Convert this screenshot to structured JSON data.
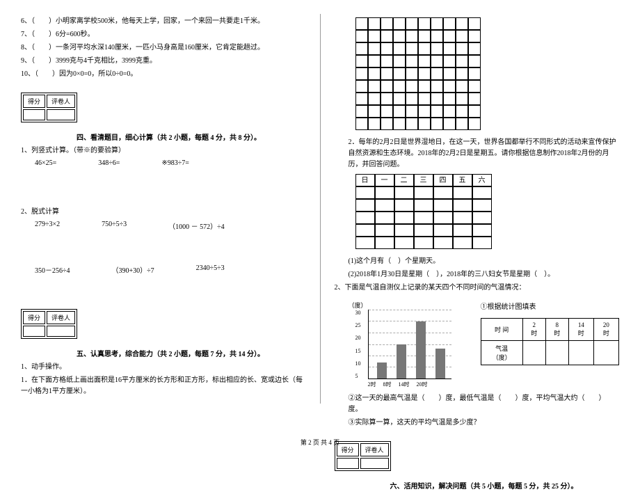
{
  "left": {
    "q6": "6、（　　）小明家离学校500米，他每天上学，回家，一个来回一共要走1千米。",
    "q7": "7、（　　）6分=600秒。",
    "q8": "8、（　　）一条河平均水深140厘米，一匹小马身高是160厘米，它肯定能趟过。",
    "q9": "9、（　　）3999克与4千克相比，3999克重。",
    "q10": "10、（　　）因为0×0=0，所以0÷0=0。",
    "score_label_1": "得分",
    "score_label_2": "评卷人",
    "section4_title": "四、看清题目，细心计算（共 2 小题，每题 4 分，共 8 分）。",
    "s4_q1": "1、列竖式计算。（带※的要验算）",
    "calc1_a": "46×25=",
    "calc1_b": "348÷6=",
    "calc1_c": "※983÷7=",
    "s4_q2": "2、脱式计算",
    "calc2_a": "279÷3×2",
    "calc2_b": "750÷5÷3",
    "calc2_c": "（1000 － 572）÷4",
    "calc3_a": "350－256÷4",
    "calc3_b": "（390+30）÷7",
    "calc3_c": "2340÷5÷3",
    "section5_title": "五、认真思考，综合能力（共 2 小题，每题 7 分，共 14 分）。",
    "s5_q1": "1、动手操作。",
    "s5_q1_sub": "1．在下面方格纸上画出面积是16平方厘米的长方形和正方形，标出相应的长、宽或边长（每一小格为1平方厘米）。"
  },
  "right": {
    "s5_q2": "2．每年的2月2日是世界湿地日，在这一天，世界各国都举行不同形式的活动来宣传保护自然资源和生态环境。2018年的2月2日是星期五。请你根据信息制作2018年2月份的月历，并回答问题。",
    "cal_days": [
      "日",
      "一",
      "二",
      "三",
      "四",
      "五",
      "六"
    ],
    "s5_q2_sub1": "(1)这个月有（　）个星期天。",
    "s5_q2_sub2": "(2)2018年1月30日是星期（　），2018年的三八妇女节是星期（　）。",
    "s5_q3": "2、下面是气温自测仪上记录的某天四个不同时间的气温情况：",
    "chart_label": "（度）",
    "chart_table_title": "①根据统计图填表",
    "table_header_time": "时  间",
    "table_header_temp": "气温（度）",
    "table_times": [
      "2时",
      "8时",
      "14时",
      "20时"
    ],
    "s5_q3_sub2": "②这一天的最高气温是（　　）度，最低气温是（　　）度，平均气温大约（　　）度。",
    "s5_q3_sub3": "③实际算一算，这天的平均气温是多少度？",
    "section6_title": "六、活用知识，解决问题（共 5 小题，每题 5 分，共 25 分）。"
  },
  "chart_data": {
    "type": "bar",
    "categories": [
      "2时",
      "8时",
      "14时",
      "20时"
    ],
    "values": [
      7,
      15,
      25,
      13
    ],
    "xlabel": "",
    "ylabel": "（度）",
    "ylim": [
      0,
      30
    ],
    "yticks": [
      5,
      10,
      15,
      20,
      25,
      30
    ]
  },
  "footer": "第 2 页 共 4 页"
}
